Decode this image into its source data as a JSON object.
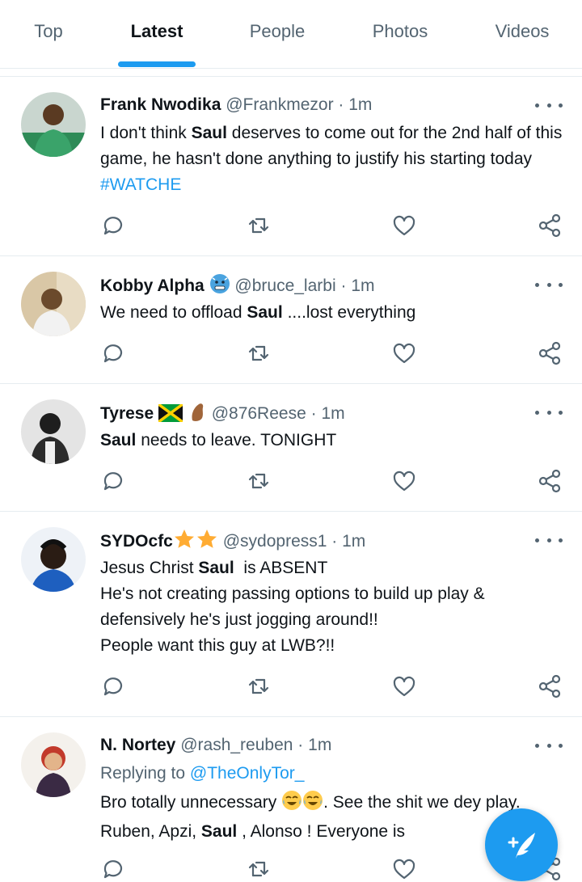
{
  "tabs": [
    "Top",
    "Latest",
    "People",
    "Photos",
    "Videos"
  ],
  "active_tab": "Latest",
  "colors": {
    "accent": "#1d9bf0",
    "text": "#0f1419",
    "muted": "#536471"
  },
  "tweets": [
    {
      "name": "Frank Nwodika",
      "handle": "@Frankmezor",
      "time": "1m",
      "body": {
        "t1": "I don't think ",
        "b1": "Saul",
        "t2": " deserves to come out for the 2nd half of this game, he hasn't done anything to justify his starting today ",
        "hashtag": "#WATCHE"
      }
    },
    {
      "name": "Kobby Alpha",
      "handle": "@bruce_larbi",
      "time": "1m",
      "name_emoji": "cold-face-emoji",
      "body": {
        "t1": "We need to offload ",
        "b1": "Saul",
        "t2": " ....lost everything"
      }
    },
    {
      "name": "Tyrese",
      "handle": "@876Reese",
      "time": "1m",
      "name_emoji": "jamaica-flag-and-arm-emoji",
      "body": {
        "b1": "Saul",
        "t1": " needs to leave. TONIGHT"
      }
    },
    {
      "name": "SYDOcfc",
      "handle": "@sydopress1",
      "time": "1m",
      "name_emoji": "two-stars-emoji",
      "body": {
        "t1": "Jesus Christ ",
        "b1": "Saul",
        "t2": "  is ABSENT",
        "l2": "He's not creating passing options to build up play & defensively he's just jogging around!!",
        "l3": "People want this guy at LWB?!!"
      }
    },
    {
      "name": "N. Nortey",
      "handle": "@rash_reuben",
      "time": "1m",
      "replying_to_label": "Replying to",
      "replying_to_handle": "@TheOnlyTor_",
      "body": {
        "t1": "Bro totally unnecessary ",
        "t2": ". See the shit we dey play. Ruben, Apzi, ",
        "b1": "Saul",
        "t3": " , Alonso ! Everyone is"
      }
    }
  ],
  "separator": "·",
  "icons": [
    "reply-icon",
    "retweet-icon",
    "like-icon",
    "share-icon",
    "more-icon",
    "compose-icon"
  ]
}
